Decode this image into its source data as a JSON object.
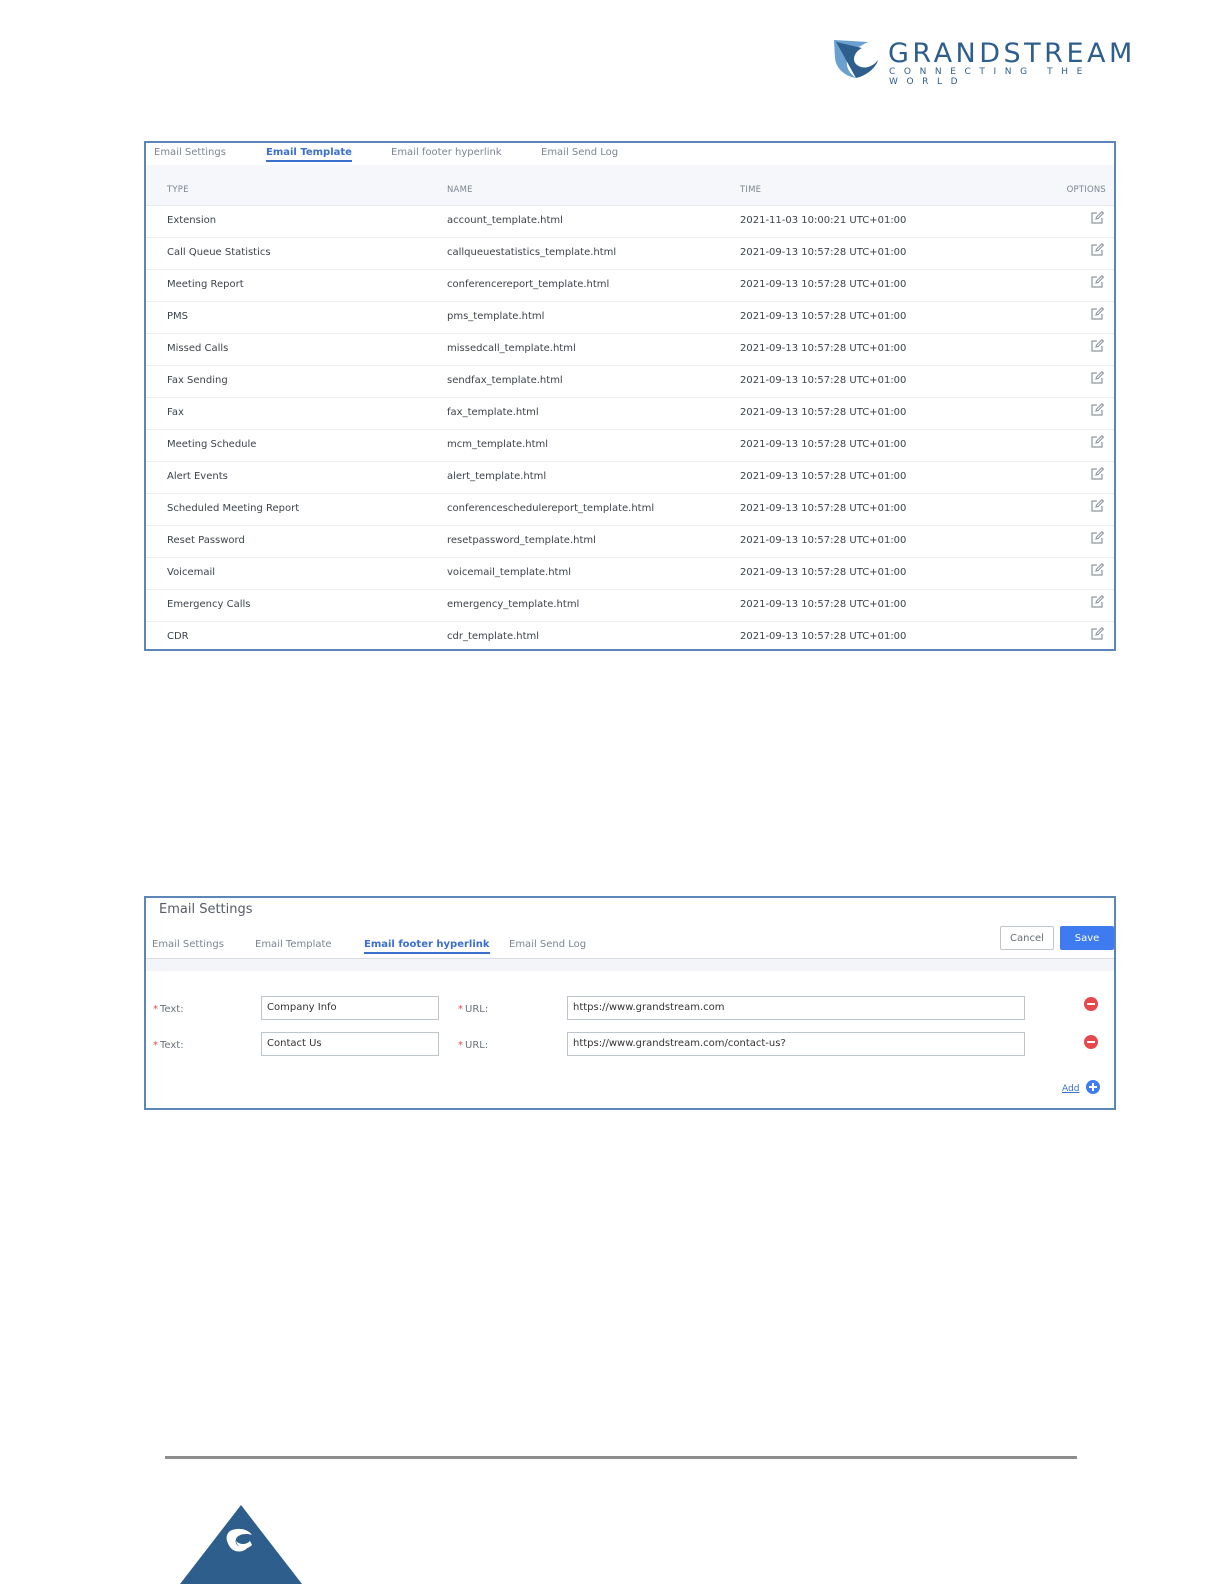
{
  "logo": {
    "name": "GRANDSTREAM",
    "tagline": "CONNECTING THE WORLD",
    "colors": {
      "primary": "#2d5e8c",
      "light": "#6aa0d0"
    }
  },
  "template_panel": {
    "tabs": [
      {
        "label": "Email Settings",
        "active": false
      },
      {
        "label": "Email Template",
        "active": true
      },
      {
        "label": "Email footer hyperlink",
        "active": false
      },
      {
        "label": "Email Send Log",
        "active": false
      }
    ],
    "columns": {
      "type": "TYPE",
      "name": "NAME",
      "time": "TIME",
      "options": "OPTIONS"
    },
    "rows": [
      {
        "type": "Extension",
        "name": "account_template.html",
        "time": "2021-11-03 10:00:21 UTC+01:00"
      },
      {
        "type": "Call Queue Statistics",
        "name": "callqueuestatistics_template.html",
        "time": "2021-09-13 10:57:28 UTC+01:00"
      },
      {
        "type": "Meeting Report",
        "name": "conferencereport_template.html",
        "time": "2021-09-13 10:57:28 UTC+01:00"
      },
      {
        "type": "PMS",
        "name": "pms_template.html",
        "time": "2021-09-13 10:57:28 UTC+01:00"
      },
      {
        "type": "Missed Calls",
        "name": "missedcall_template.html",
        "time": "2021-09-13 10:57:28 UTC+01:00"
      },
      {
        "type": "Fax Sending",
        "name": "sendfax_template.html",
        "time": "2021-09-13 10:57:28 UTC+01:00"
      },
      {
        "type": "Fax",
        "name": "fax_template.html",
        "time": "2021-09-13 10:57:28 UTC+01:00"
      },
      {
        "type": "Meeting Schedule",
        "name": "mcm_template.html",
        "time": "2021-09-13 10:57:28 UTC+01:00"
      },
      {
        "type": "Alert Events",
        "name": "alert_template.html",
        "time": "2021-09-13 10:57:28 UTC+01:00"
      },
      {
        "type": "Scheduled Meeting Report",
        "name": "conferenceschedulereport_template.html",
        "time": "2021-09-13 10:57:28 UTC+01:00"
      },
      {
        "type": "Reset Password",
        "name": "resetpassword_template.html",
        "time": "2021-09-13 10:57:28 UTC+01:00"
      },
      {
        "type": "Voicemail",
        "name": "voicemail_template.html",
        "time": "2021-09-13 10:57:28 UTC+01:00"
      },
      {
        "type": "Emergency Calls",
        "name": "emergency_template.html",
        "time": "2021-09-13 10:57:28 UTC+01:00"
      },
      {
        "type": "CDR",
        "name": "cdr_template.html",
        "time": "2021-09-13 10:57:28 UTC+01:00"
      }
    ],
    "row_icon": "edit-icon"
  },
  "footer_panel": {
    "title": "Email Settings",
    "tabs": [
      {
        "label": "Email Settings",
        "active": false
      },
      {
        "label": "Email Template",
        "active": false
      },
      {
        "label": "Email footer hyperlink",
        "active": true
      },
      {
        "label": "Email Send Log",
        "active": false
      }
    ],
    "cancel_label": "Cancel",
    "save_label": "Save",
    "text_label": "Text:",
    "url_label": "URL:",
    "required_mark": "*",
    "links": [
      {
        "text": "Company Info",
        "url": "https://www.grandstream.com"
      },
      {
        "text": "Contact Us",
        "url": "https://www.grandstream.com/contact-us?"
      }
    ],
    "add_label": "Add",
    "colors": {
      "accent": "#3e7bf0",
      "remove": "#e5484d"
    }
  },
  "footer": {
    "logo_icon": "grandstream-mark-icon",
    "color": "#2d5e8c"
  }
}
